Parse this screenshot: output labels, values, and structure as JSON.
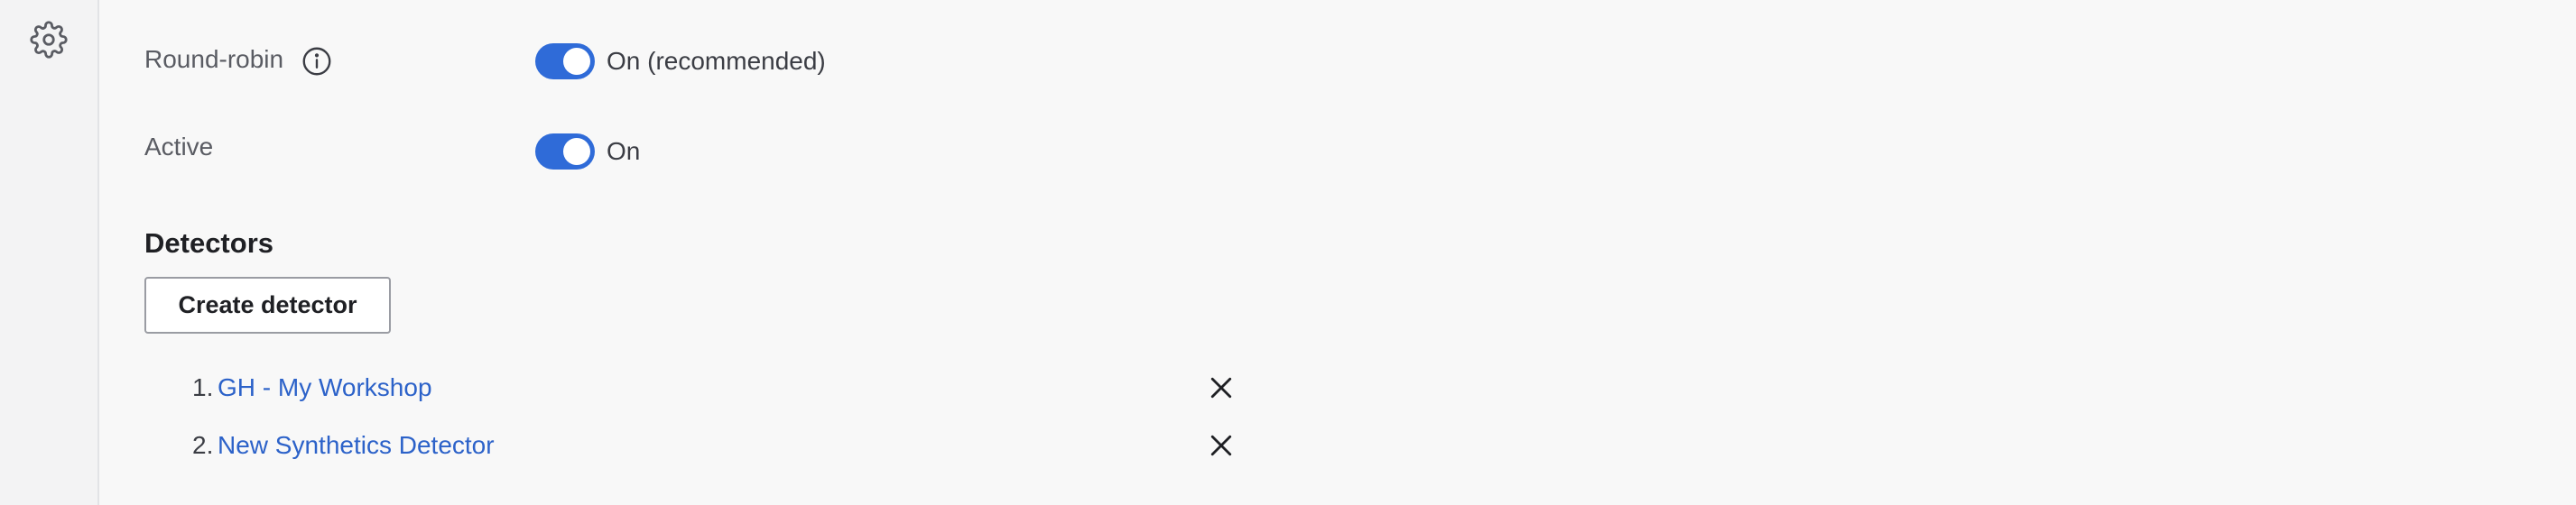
{
  "sidebar": {
    "settings_icon": "gear-icon"
  },
  "settings": {
    "round_robin": {
      "label": "Round-robin",
      "icon": "info-icon",
      "state": "on",
      "status_text": "On (recommended)"
    },
    "active": {
      "label": "Active",
      "state": "on",
      "status_text": "On"
    }
  },
  "detectors": {
    "title": "Detectors",
    "create_button_label": "Create detector",
    "remove_icon": "close-icon",
    "items": [
      {
        "number": "1.",
        "name": "GH - My Workshop"
      },
      {
        "number": "2.",
        "name": "New Synthetics Detector"
      }
    ]
  },
  "colors": {
    "accent": "#2f6bd8",
    "link": "#2c62c9",
    "background": "#f8f8f8"
  }
}
